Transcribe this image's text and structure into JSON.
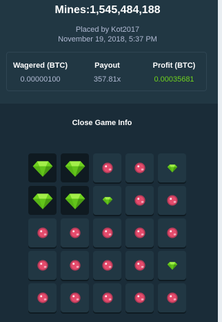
{
  "game": {
    "title": "Mines:1,545,484,188",
    "placed_by": "Placed by Kot2017",
    "date": "November 19, 2018, 5:37 PM"
  },
  "stats": {
    "wagered_label": "Wagered (BTC)",
    "wagered_value": "0.00000100",
    "payout_label": "Payout",
    "payout_value": "357.81x",
    "profit_label": "Profit (BTC)",
    "profit_value": "0.00035681"
  },
  "close_label": "Close Game Info",
  "colors": {
    "profit": "#6fd11e",
    "gem": "#6fd11e",
    "mine": "#e54b6c"
  },
  "board": [
    [
      "gem-revealed",
      "gem-revealed",
      "mine",
      "mine",
      "gem"
    ],
    [
      "gem-revealed",
      "gem-revealed",
      "gem",
      "mine",
      "mine"
    ],
    [
      "mine",
      "mine",
      "mine",
      "mine",
      "mine"
    ],
    [
      "mine",
      "mine",
      "mine",
      "mine",
      "gem"
    ],
    [
      "mine",
      "mine",
      "mine",
      "mine",
      "mine"
    ]
  ]
}
